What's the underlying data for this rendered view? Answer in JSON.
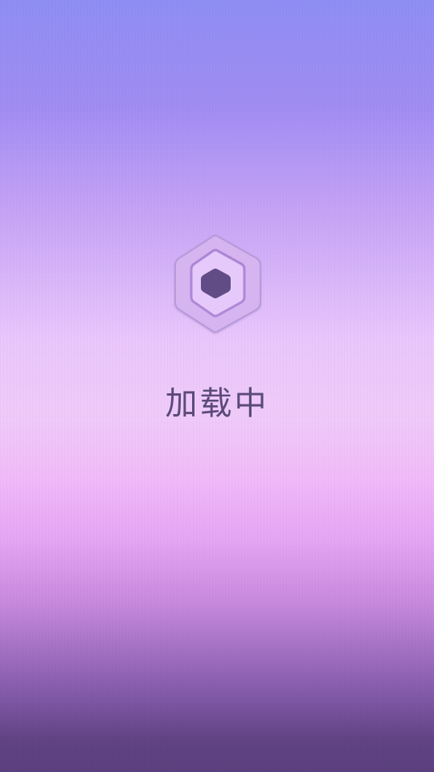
{
  "screen": {
    "status_text": "加载中"
  },
  "icon": {
    "name": "hexagon-loader-icon"
  },
  "colors": {
    "text": "#5b4a7a",
    "hex_outer_fill": "#d6b4f0",
    "hex_outer_stroke": "#b79ad9",
    "hex_mid_fill": "#e6c9fb",
    "hex_mid_stroke": "#b18ad8",
    "hex_inner_fill": "#614c86"
  }
}
